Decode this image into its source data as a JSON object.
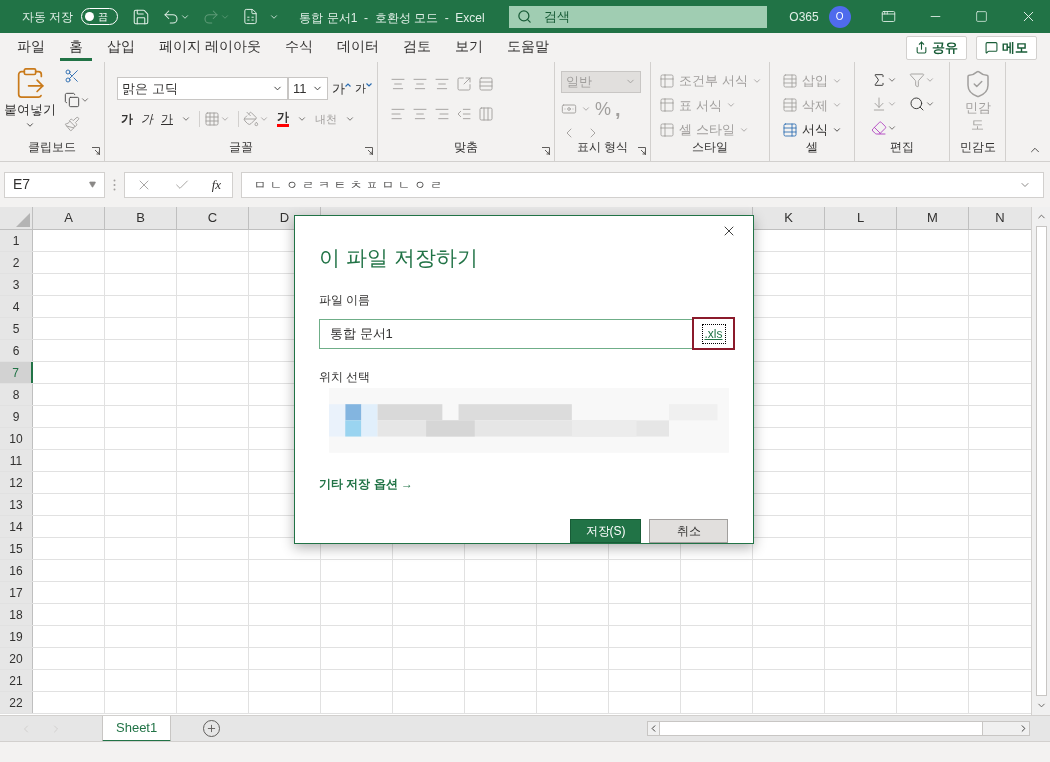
{
  "title_bar": {
    "autosave_label": "자동 저장",
    "autosave": {
      "on": false,
      "label": "끔"
    },
    "redo_disabled": true,
    "title": "통합 문서1  -  호환성 모드  -  Excel",
    "search_placeholder": "검색",
    "account": "O365",
    "avatar": "O"
  },
  "menu_tabs": [
    {
      "label": "파일",
      "selected": false
    },
    {
      "label": "홈",
      "selected": true
    },
    {
      "label": "삽입",
      "selected": false
    },
    {
      "label": "페이지 레이아웃",
      "selected": false
    },
    {
      "label": "수식",
      "selected": false
    },
    {
      "label": "데이터",
      "selected": false
    },
    {
      "label": "검토",
      "selected": false
    },
    {
      "label": "보기",
      "selected": false
    },
    {
      "label": "도움말",
      "selected": false
    }
  ],
  "share_button": "공유",
  "comments_button": "메모",
  "ribbon": {
    "clipboard": {
      "label": "클립보드",
      "paste": "붙여넣기"
    },
    "font": {
      "label": "글꼴",
      "font_name": "맑은 고딕",
      "font_size": "11",
      "grow": "가",
      "shrink": "가",
      "bold": "가",
      "italic": "가",
      "underline": "가",
      "font_color_sample": "가",
      "phonetic": {
        "label": "내천",
        "disabled": true
      }
    },
    "alignment": {
      "label": "맞춤"
    },
    "number": {
      "label": "표시 형식",
      "format": {
        "value": "일반",
        "disabled": true
      },
      "percent": "%",
      "comma": ","
    },
    "styles": {
      "label": "스타일",
      "items": [
        {
          "label": "조건부 서식",
          "disabled": true
        },
        {
          "label": "표 서식",
          "disabled": true
        },
        {
          "label": "셀 스타일",
          "disabled": true
        }
      ]
    },
    "cells": {
      "label": "셀",
      "items": [
        {
          "label": "삽입",
          "disabled": true
        },
        {
          "label": "삭제",
          "disabled": true
        },
        {
          "label": "서식",
          "disabled": false
        }
      ]
    },
    "editing": {
      "label": "편집"
    },
    "sensitivity": {
      "label": "민감도",
      "button": {
        "label": "민감도",
        "disabled": true
      }
    }
  },
  "formula_bar": {
    "name_box": "E7",
    "function_label": "fx",
    "formula": "ㅁㄴㅇㄹㅋㅌㅊㅍㅁㄴㅇㄹ"
  },
  "grid": {
    "columns_left": [
      {
        "label": "A",
        "selected": false
      },
      {
        "label": "B",
        "selected": false
      },
      {
        "label": "C",
        "selected": false
      },
      {
        "label": "D",
        "selected": false
      }
    ],
    "columns_right": [
      {
        "label": "K",
        "selected": false
      },
      {
        "label": "L",
        "selected": false
      },
      {
        "label": "M",
        "selected": false
      },
      {
        "label": "N",
        "selected": false
      }
    ],
    "rows": [
      {
        "label": "1",
        "selected": false
      },
      {
        "label": "2",
        "selected": false
      },
      {
        "label": "3",
        "selected": false
      },
      {
        "label": "4",
        "selected": false
      },
      {
        "label": "5",
        "selected": false
      },
      {
        "label": "6",
        "selected": false
      },
      {
        "label": "7",
        "selected": true
      },
      {
        "label": "8",
        "selected": false
      },
      {
        "label": "9",
        "selected": false
      },
      {
        "label": "10",
        "selected": false
      },
      {
        "label": "11",
        "selected": false
      },
      {
        "label": "12",
        "selected": false
      },
      {
        "label": "13",
        "selected": false
      },
      {
        "label": "14",
        "selected": false
      },
      {
        "label": "15",
        "selected": false
      },
      {
        "label": "16",
        "selected": false
      },
      {
        "label": "17",
        "selected": false
      },
      {
        "label": "18",
        "selected": false
      },
      {
        "label": "19",
        "selected": false
      },
      {
        "label": "20",
        "selected": false
      },
      {
        "label": "21",
        "selected": false
      },
      {
        "label": "22",
        "selected": false
      }
    ]
  },
  "sheet_tabs": [
    {
      "label": "Sheet1",
      "selected": true
    }
  ],
  "dialog": {
    "title": "이 파일 저장하기",
    "file_name_label": "파일 이름",
    "file_name": "통합 문서1",
    "extension": {
      "label": ".xls",
      "highlighted": true
    },
    "location_label": "위치 선택",
    "more_options": "기타 저장 옵션 →",
    "save_button": "저장(S)",
    "cancel_button": "취소"
  }
}
